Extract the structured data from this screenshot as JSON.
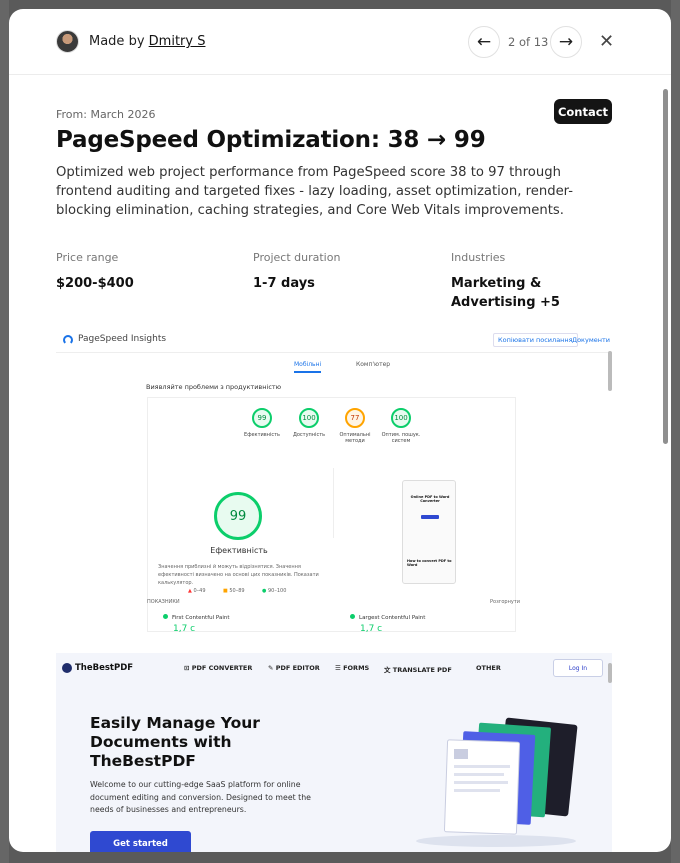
{
  "header": {
    "author_prefix": "Made by",
    "author_name": "Dmitry S",
    "pager": "2 of 13"
  },
  "project": {
    "date": "From: March 2026",
    "contact_label": "Contact",
    "title": "PageSpeed Optimization: 38 → 99",
    "description": "Optimized web project performance from PageSpeed score 38 to 97 through frontend auditing and targeted fixes - lazy loading, asset optimization, render-blocking elimination, caching strategies, and Core Web Vitals improvements.",
    "meta": [
      {
        "label": "Price range",
        "value": "$200-$400"
      },
      {
        "label": "Project duration",
        "value": "1-7 days"
      },
      {
        "label": "Industries",
        "value": "Marketing & Advertising +5"
      }
    ]
  },
  "pagespeed_shot": {
    "app_name": "PageSpeed Insights",
    "copy_link": "Копіювати посилання",
    "docs": "Документи",
    "tab_mobile": "Мобільні",
    "tab_desktop": "Комп'ютер",
    "check_label": "Виявляйте проблеми з продуктивністю",
    "scores": [
      {
        "value": "99",
        "label": "Ефективність"
      },
      {
        "value": "100",
        "label": "Доступність"
      },
      {
        "value": "77",
        "label": "Оптимальні методи"
      },
      {
        "value": "100",
        "label": "Оптим. пошук. систем"
      }
    ],
    "big_score": "99",
    "big_label": "Ефективність",
    "note": "Значення приблизні й можуть відрізнятися. Значення ефективності визначено на основі цих показників. Показати калькулятор.",
    "legend": [
      "0–49",
      "50–89",
      "90–100"
    ],
    "metrics_header": "ПОКАЗНИКИ",
    "expand": "Розгорнути",
    "metric1_label": "First Contentful Paint",
    "metric1_value": "1,7 с",
    "metric2_label": "Largest Contentful Paint",
    "metric2_value": "1,7 с",
    "phone_title": "Online PDF to Word Converter",
    "phone_subtitle": "How to convert PDF to Word"
  },
  "thebestpdf_shot": {
    "brand": "TheBestPDF",
    "nav": [
      "PDF CONVERTER",
      "PDF EDITOR",
      "FORMS",
      "TRANSLATE PDF",
      "OTHER"
    ],
    "login": "Log In",
    "headline": "Easily Manage Your Documents with TheBestPDF",
    "subtext": "Welcome to our cutting-edge SaaS platform for online document editing and conversion. Designed to meet the needs of businesses and entrepreneurs.",
    "cta": "Get started"
  },
  "colors": {
    "accent": "#1a73e8",
    "good": "#0cce6b",
    "average": "#ffa400",
    "cta_blue": "#2f49d1"
  }
}
